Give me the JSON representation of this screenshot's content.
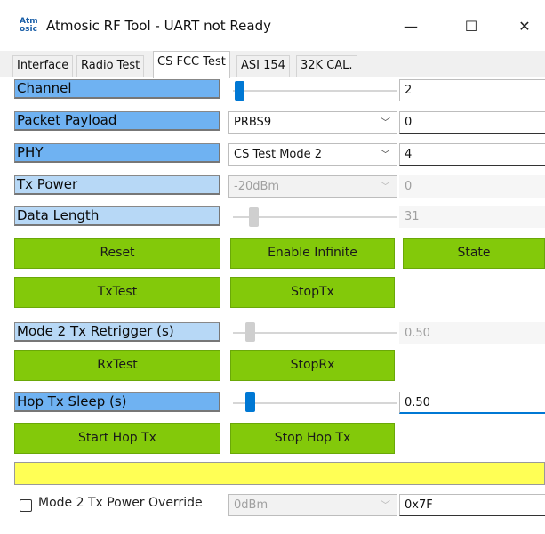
{
  "window": {
    "logo_top": "Atm",
    "logo_bottom": "osic",
    "title": "Atmosic RF Tool - UART not Ready",
    "minimize": "—",
    "maximize": "☐",
    "close": "✕"
  },
  "tabs": [
    "Interface",
    "Radio Test",
    "CS FCC Test",
    "ASI 154",
    "32K CAL."
  ],
  "active_tab": "CS FCC Test",
  "rows": {
    "channel": {
      "label": "Channel",
      "value": "2"
    },
    "packet_payload": {
      "label": "Packet Payload",
      "selected": "PRBS9",
      "value": "0"
    },
    "phy": {
      "label": "PHY",
      "selected": "CS Test Mode 2",
      "value": "4"
    },
    "tx_power": {
      "label": "Tx Power",
      "selected": "-20dBm",
      "value": "0"
    },
    "data_length": {
      "label": "Data Length",
      "value": "31"
    },
    "mode2_retrigger": {
      "label": "Mode 2 Tx Retrigger (s)",
      "value": "0.50"
    },
    "hop_sleep": {
      "label": "Hop Tx Sleep (s)",
      "value": "0.50"
    }
  },
  "buttons": {
    "reset": "Reset",
    "enable_infinite": "Enable Infinite",
    "state": "State",
    "txtest": "TxTest",
    "stoptx": "StopTx",
    "rxtest": "RxTest",
    "stoprx": "StopRx",
    "start_hop": "Start Hop Tx",
    "stop_hop": "Stop Hop Tx"
  },
  "status_text": "",
  "override": {
    "label": "Mode 2 Tx Power Override",
    "selected": "0dBm",
    "value": "0x7F",
    "checked": false
  },
  "colors": {
    "label_bg": "#6fb2f2",
    "button_bg": "#83c90a",
    "status_bg": "#ffff55",
    "slider_thumb": "#0078d4"
  }
}
